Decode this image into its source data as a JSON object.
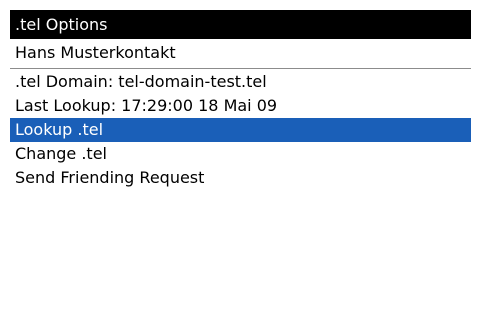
{
  "screen": {
    "title": ".tel Options",
    "contact_name": "Hans Musterkontakt",
    "info": {
      "domain": ".tel Domain: tel-domain-test.tel",
      "last_lookup": "Last Lookup: 17:29:00 18 Mai 09"
    },
    "menu": {
      "items": [
        {
          "label": "Lookup .tel"
        },
        {
          "label": "Change .tel"
        },
        {
          "label": "Send Friending Request"
        }
      ],
      "selected_label": "Lookup .tel"
    }
  },
  "colors": {
    "title_background": "#000000",
    "title_text": "#ffffff",
    "selection_background": "#1a5fb8",
    "selection_text": "#ffffff",
    "divider": "#8c8c8c"
  }
}
